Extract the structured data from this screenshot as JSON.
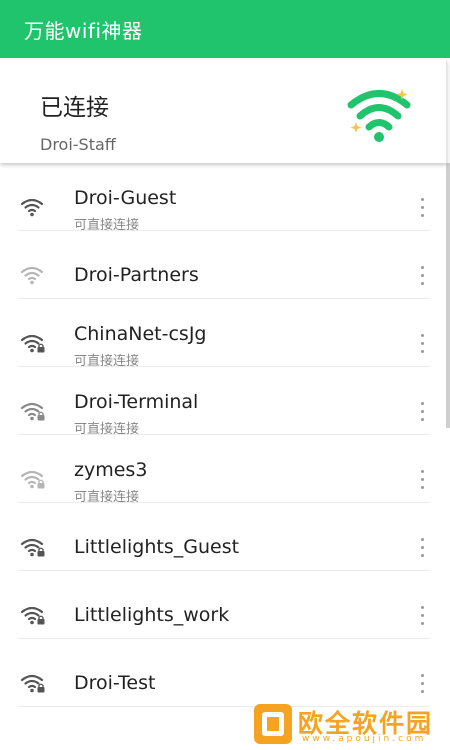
{
  "appbar": {
    "title": "万能wifi神器"
  },
  "status": {
    "label": "已连接",
    "ssid": "Droi-Staff"
  },
  "colors": {
    "brand_green": "#20c46c",
    "sparkle": "#f5c84b",
    "watermark": "#f5a321"
  },
  "networks": [
    {
      "name": "Droi-Guest",
      "sub": "可直接连接",
      "locked": false,
      "strength": "strong"
    },
    {
      "name": "Droi-Partners",
      "sub": "",
      "locked": false,
      "strength": "weak"
    },
    {
      "name": "ChinaNet-csJg",
      "sub": "可直接连接",
      "locked": true,
      "strength": "strong"
    },
    {
      "name": "Droi-Terminal",
      "sub": "可直接连接",
      "locked": true,
      "strength": "medium"
    },
    {
      "name": "zymes3",
      "sub": "可直接连接",
      "locked": true,
      "strength": "weak"
    },
    {
      "name": "Littlelights_Guest",
      "sub": "",
      "locked": true,
      "strength": "strong"
    },
    {
      "name": "Littlelights_work",
      "sub": "",
      "locked": true,
      "strength": "strong"
    },
    {
      "name": "Droi-Test",
      "sub": "",
      "locked": true,
      "strength": "strong"
    }
  ],
  "watermark": {
    "text": "欧全软件园",
    "sub": "www.apoujin.com"
  }
}
